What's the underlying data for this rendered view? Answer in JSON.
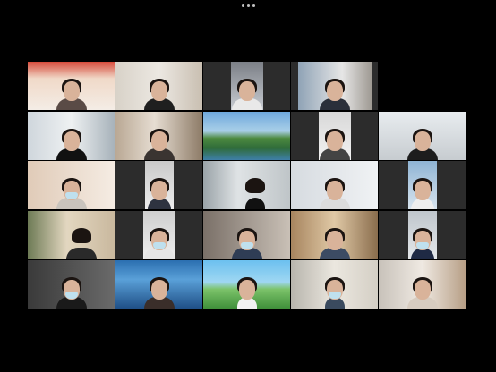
{
  "window": {
    "more_menu_icon": "more-dots-icon"
  },
  "gallery": {
    "tiles": [
      {
        "name": "",
        "has_video": true
      },
      {
        "name": "",
        "has_video": true
      },
      {
        "name": "",
        "has_video": true
      },
      {
        "name": "",
        "has_video": true
      },
      {
        "name": "",
        "has_video": false
      },
      {
        "name": "",
        "has_video": true
      },
      {
        "name": "",
        "has_video": true
      },
      {
        "name": "",
        "has_video": true
      },
      {
        "name": "",
        "has_video": true
      },
      {
        "name": "",
        "has_video": true
      },
      {
        "name": "",
        "has_video": true
      },
      {
        "name": "",
        "has_video": true
      },
      {
        "name": "",
        "has_video": true
      },
      {
        "name": "",
        "has_video": true
      },
      {
        "name": "",
        "has_video": true
      },
      {
        "name": "",
        "has_video": true
      },
      {
        "name": "",
        "has_video": true
      },
      {
        "name": "",
        "has_video": true
      },
      {
        "name": "",
        "has_video": true
      },
      {
        "name": "",
        "has_video": true
      },
      {
        "name": "",
        "has_video": true
      },
      {
        "name": "",
        "has_video": true
      },
      {
        "name": "",
        "has_video": true
      },
      {
        "name": "",
        "has_video": true
      },
      {
        "name": "",
        "has_video": true
      }
    ]
  }
}
